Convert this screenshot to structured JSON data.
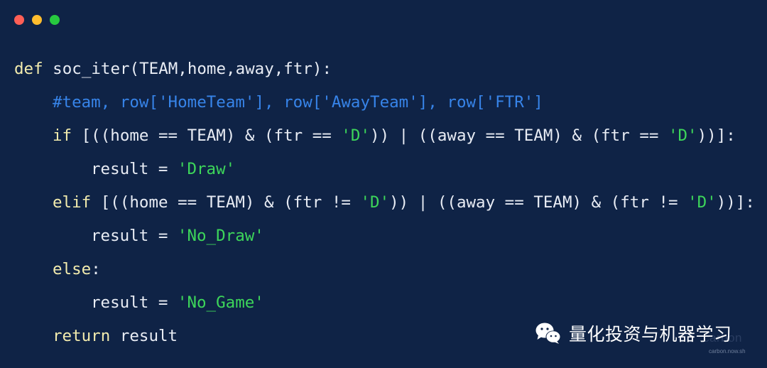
{
  "window": {
    "controls": [
      {
        "name": "close",
        "color": "#ff5f56"
      },
      {
        "name": "minimize",
        "color": "#ffbd2e"
      },
      {
        "name": "maximize",
        "color": "#27c93f"
      }
    ]
  },
  "code": {
    "lines": [
      {
        "indent": 0,
        "tokens": [
          {
            "t": "kw",
            "v": "def"
          },
          {
            "t": "plain",
            "v": " soc_iter(TEAM,home,away,ftr):"
          }
        ]
      },
      {
        "indent": 1,
        "tokens": [
          {
            "t": "com",
            "v": "#team, row['HomeTeam'], row['AwayTeam'], row['FTR']"
          }
        ]
      },
      {
        "indent": 1,
        "tokens": [
          {
            "t": "kw",
            "v": "if"
          },
          {
            "t": "plain",
            "v": " [((home == TEAM) & (ftr == "
          },
          {
            "t": "str",
            "v": "'D'"
          },
          {
            "t": "plain",
            "v": ")) | ((away == TEAM) & (ftr == "
          },
          {
            "t": "str",
            "v": "'D'"
          },
          {
            "t": "plain",
            "v": "))]:"
          }
        ]
      },
      {
        "indent": 2,
        "tokens": [
          {
            "t": "plain",
            "v": "result = "
          },
          {
            "t": "str",
            "v": "'Draw'"
          }
        ]
      },
      {
        "indent": 1,
        "tokens": [
          {
            "t": "kw",
            "v": "elif"
          },
          {
            "t": "plain",
            "v": " [((home == TEAM) & (ftr != "
          },
          {
            "t": "str",
            "v": "'D'"
          },
          {
            "t": "plain",
            "v": ")) | ((away == TEAM) & (ftr != "
          },
          {
            "t": "str",
            "v": "'D'"
          },
          {
            "t": "plain",
            "v": "))]:"
          }
        ]
      },
      {
        "indent": 2,
        "tokens": [
          {
            "t": "plain",
            "v": "result = "
          },
          {
            "t": "str",
            "v": "'No_Draw'"
          }
        ]
      },
      {
        "indent": 1,
        "tokens": [
          {
            "t": "kw",
            "v": "else"
          },
          {
            "t": "plain",
            "v": ":"
          }
        ]
      },
      {
        "indent": 2,
        "tokens": [
          {
            "t": "plain",
            "v": "result = "
          },
          {
            "t": "str",
            "v": "'No_Game'"
          }
        ]
      },
      {
        "indent": 1,
        "tokens": [
          {
            "t": "kw",
            "v": "return"
          },
          {
            "t": "plain",
            "v": " result"
          }
        ]
      }
    ]
  },
  "watermark": {
    "icon": "wechat-icon",
    "text": "量化投资与机器学习"
  },
  "carbon": {
    "mark": "carbon",
    "url": "carbon.now.sh"
  }
}
